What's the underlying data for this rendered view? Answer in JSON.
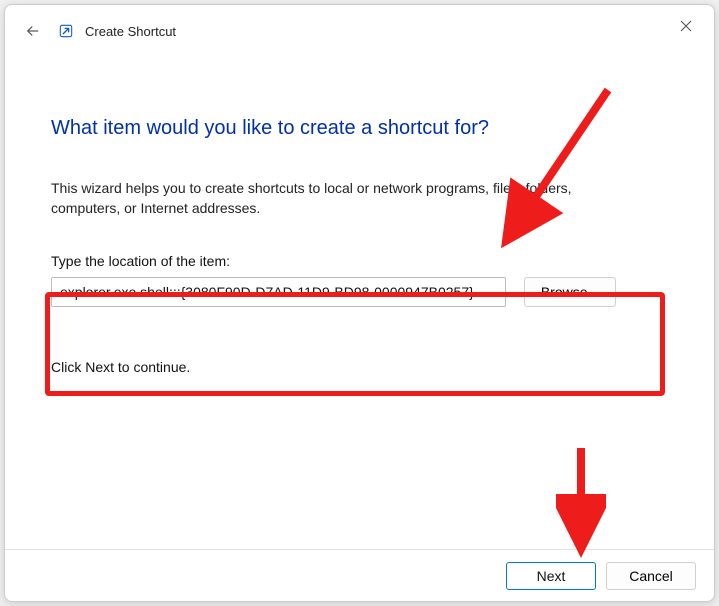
{
  "titlebar": {
    "title": "Create Shortcut"
  },
  "main": {
    "heading": "What item would you like to create a shortcut for?",
    "description": "This wizard helps you to create shortcuts to local or network programs, files, folders, computers, or Internet addresses.",
    "field_label": "Type the location of the item:",
    "location_value": "explorer.exe shell:::{3080F90D-D7AD-11D9-BD98-0000947B0257}.",
    "browse_label": "Browse...",
    "continue_text": "Click Next to continue."
  },
  "footer": {
    "next_label": "Next",
    "cancel_label": "Cancel"
  },
  "annotation": {
    "highlight_color": "#ef1c1c",
    "arrow_color": "#ef1c1c"
  }
}
